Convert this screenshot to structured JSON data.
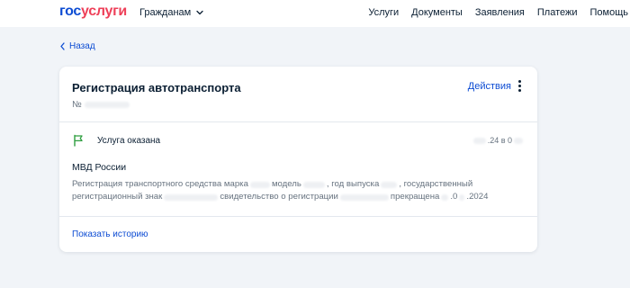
{
  "header": {
    "logo_part1": "гос",
    "logo_part2": "услуги",
    "audience_label": "Гражданам",
    "nav": [
      "Услуги",
      "Документы",
      "Заявления",
      "Платежи",
      "Помощь"
    ]
  },
  "back_label": "Назад",
  "card": {
    "title": "Регистрация автотранспорта",
    "number_prefix": "№",
    "actions_label": "Действия",
    "status": "Услуга оказана",
    "status_date_parts": [
      ".24 в 0"
    ],
    "org": "МВД России",
    "description_line1": [
      "Регистрация транспортного средства марка",
      "модель",
      ", год выпуска",
      ", государственный"
    ],
    "description_line2": [
      "регистрационный знак",
      "свидетельство о регистрации",
      "прекращена",
      ".0",
      ".2024"
    ],
    "history_link": "Показать историю"
  },
  "colors": {
    "brand_blue": "#0d4cd3",
    "brand_red": "#ee3f58",
    "status_green": "#2e9e3f",
    "background": "#f1f4f8"
  },
  "icons": {
    "audience_chevron": "chevron-down-icon",
    "back": "chevron-left-icon",
    "status": "flag-icon",
    "actions": "kebab-menu-icon"
  }
}
